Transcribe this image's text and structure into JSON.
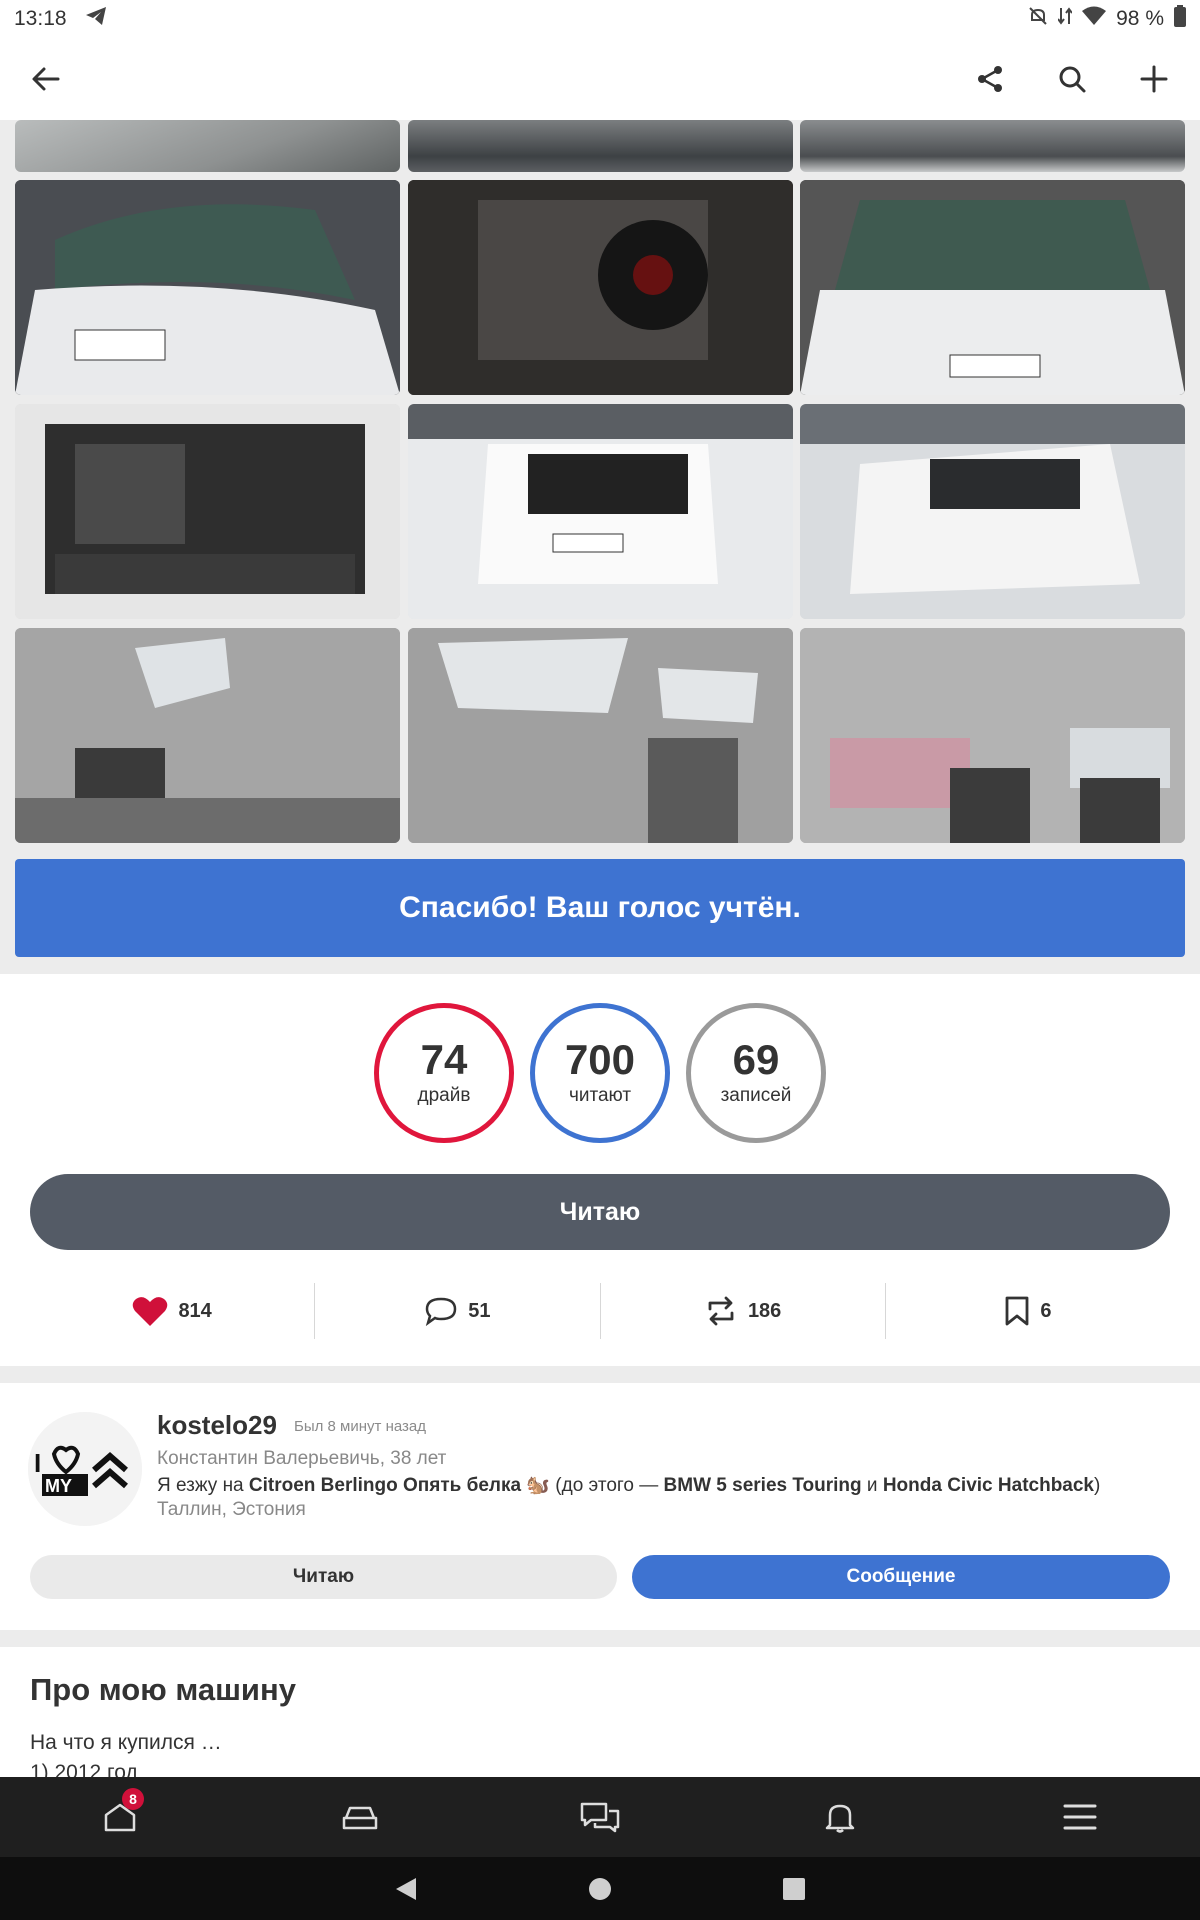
{
  "status_bar": {
    "time": "13:18",
    "battery": "98 %"
  },
  "app_bar": {
    "back_icon": "arrow-left-icon",
    "share_icon": "share-icon",
    "search_icon": "search-icon",
    "add_icon": "plus-icon"
  },
  "gallery": {
    "photos": [
      "car-interior-rear-seats",
      "steering-wheel",
      "steering-wheel-dashboard",
      "hood-art-white-car",
      "subwoofer-box-trunk",
      "hood-art-front-view",
      "open-trunk",
      "white-car-rear-snow",
      "white-car-front-snow",
      "panoramic-roof-left",
      "panoramic-roof-center",
      "interior-front-seats"
    ]
  },
  "vote_banner": {
    "text": "Спасибо! Ваш голос учтён."
  },
  "stats": [
    {
      "value": "74",
      "label": "драйв",
      "color": "#e0163c"
    },
    {
      "value": "700",
      "label": "читают",
      "color": "#3e73d1"
    },
    {
      "value": "69",
      "label": "записей",
      "color": "#9a9a9a"
    }
  ],
  "follow_button": {
    "label": "Читаю"
  },
  "actions": {
    "likes": "814",
    "comments": "51",
    "reposts": "186",
    "bookmarks": "6"
  },
  "author": {
    "username": "kostelo29",
    "last_seen": "Был 8 минут назад",
    "name_age": "Константин Валерьевичь, 38 лет",
    "drive_prefix": "Я езжу на ",
    "current_car": "Citroen Berlingo Опять белка",
    "drive_mid": " 🐿️ (до этого — ",
    "car2": "BMW 5 series Touring",
    "and": " и ",
    "car3": "Honda Civic Hatchback",
    "close": ")",
    "location": "Таллин, Эстония",
    "read_label": "Читаю",
    "message_label": "Сообщение"
  },
  "about": {
    "title": "Про мою машину",
    "line1": "На что я купился …",
    "line2": "1) 2012 год"
  },
  "bottom_nav": {
    "home_badge": "8"
  }
}
